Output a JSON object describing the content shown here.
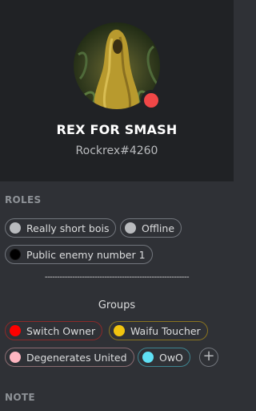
{
  "profile": {
    "username": "REX FOR SMASH",
    "tag": "Rockrex#4260",
    "status_color": "#f04747"
  },
  "roles_section": {
    "title": "ROLES",
    "roles": [
      {
        "label": "Really short bois",
        "color": "#b9bbbe"
      },
      {
        "label": "Offline",
        "color": "#b9bbbe"
      },
      {
        "label": "Public enemy number 1",
        "color": "#000000"
      }
    ],
    "divider": "----------------------------------------------------------",
    "groups_label": "Groups",
    "group_roles": [
      {
        "label": "Switch Owner",
        "color": "#ff0000",
        "border": "#8b2a2a"
      },
      {
        "label": "Waifu Toucher",
        "color": "#f1c40f",
        "border": "#8a7420"
      },
      {
        "label": "Degenerates United",
        "color": "#ffb6c1",
        "border": "#8b6c72"
      },
      {
        "label": "OwO",
        "color": "#5fe1f5",
        "border": "#3f8591"
      }
    ],
    "add_label": "+"
  },
  "note_section": {
    "title": "NOTE"
  }
}
